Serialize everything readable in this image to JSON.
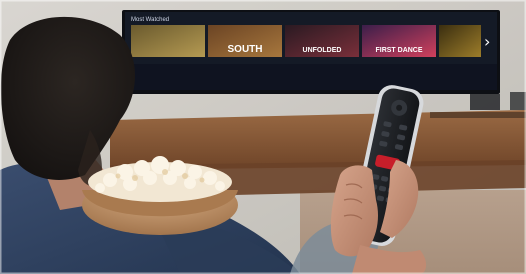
{
  "scene": {
    "description_colors": {
      "wall": "#c9c6c0",
      "tv_frame": "#0d0f14",
      "tv_screen": "#141a26",
      "table_wood": "#8a5a38",
      "sweater": "#2e3f5c",
      "skin": "#c7937a",
      "hair": "#1e1a17",
      "popcorn": "#f4ead8",
      "bowl": "#c29466",
      "remote_body": "#1d2024",
      "remote_edge": "#d7d9dc",
      "remote_red_button": "#c81e2a"
    }
  },
  "tv": {
    "row_title": "Most Watched",
    "tiles": [
      {
        "label": "",
        "color_a": "#6a5a2e",
        "color_b": "#b59a52"
      },
      {
        "label": "SOUTH",
        "color_a": "#6b4424",
        "color_b": "#a7773d"
      },
      {
        "label": "UNFOLDED",
        "color_a": "#2a1a22",
        "color_b": "#7a2f3a"
      },
      {
        "label": "FIRST DANCE",
        "color_a": "#3b1e4a",
        "color_b": "#d1405c"
      },
      {
        "label": "",
        "color_a": "#3a2e10",
        "color_b": "#9d7d2a"
      }
    ],
    "next_arrow": "›"
  }
}
